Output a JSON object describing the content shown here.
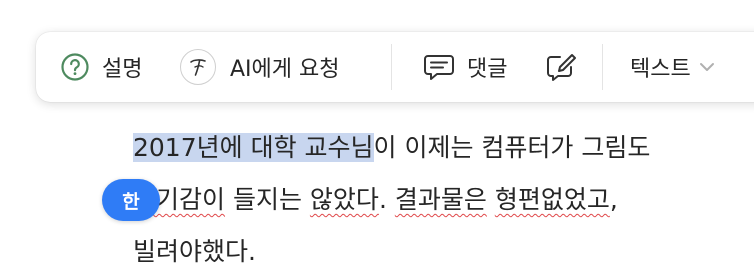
{
  "toolbar": {
    "explain_label": "설명",
    "ai_label": "AI에게 요청",
    "comment_label": "댓글",
    "text_label": "텍스트",
    "icons": {
      "explain": "question-circle-icon",
      "ai": "ai-pen-icon",
      "comment": "comment-bubble-icon",
      "edit": "edit-note-icon",
      "dropdown": "chevron-down-icon"
    }
  },
  "content": {
    "line1_highlighted": "2017년에 대학 교수님",
    "line1_rest": "이 이제는 컴퓨터가 그림도 ",
    "line2_a": " ",
    "line2_word1": "위기감이",
    "line2_b": " 들지는 ",
    "line2_word2": "않았다",
    "line2_c": ". ",
    "line2_word3": "결과물은",
    "line2_d": " ",
    "line2_word4": "형편없었고",
    "line2_e": ",",
    "line3": "빌려야했다."
  },
  "ime_badge": "한",
  "colors": {
    "selection": "#c8d6ef",
    "ime_badge": "#2f7cf6",
    "spellcheck": "#e0484a",
    "explain_icon": "#4e8a5f"
  }
}
